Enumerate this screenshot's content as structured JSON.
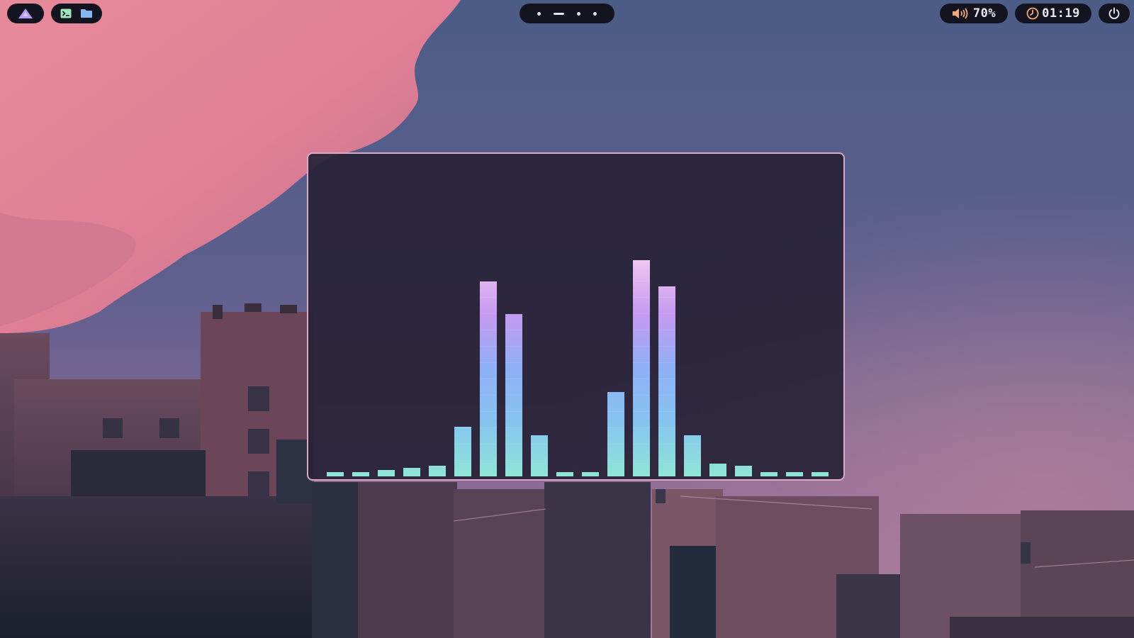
{
  "topbar": {
    "launcher": {
      "icon": "arch-logo-icon"
    },
    "apps": [
      {
        "icon": "terminal-icon"
      },
      {
        "icon": "folder-icon"
      }
    ],
    "workspaces": [
      {
        "active": false
      },
      {
        "active": true
      },
      {
        "active": false
      },
      {
        "active": false
      }
    ],
    "volume": {
      "icon": "speaker-volume-icon",
      "label": "70%"
    },
    "clock": {
      "icon": "clock-icon",
      "time": "01:19"
    },
    "power": {
      "icon": "power-icon"
    }
  },
  "colors": {
    "bar_background": "#141420",
    "window_border": "#d9a9c6",
    "window_background": "#2a2338",
    "bar_gradient": [
      "#8fe6d6",
      "#86c4f0",
      "#8fb0f6",
      "#c69af0",
      "#eec6f0"
    ],
    "volume_icon": "#f0a878",
    "clock_icon": "#f0a878"
  },
  "visualizer": {
    "bar_levels": [
      0.02,
      0.02,
      0.03,
      0.04,
      0.05,
      0.23,
      0.9,
      0.75,
      0.19,
      0.02,
      0.02,
      0.39,
      1.0,
      0.88,
      0.19,
      0.06,
      0.05,
      0.02,
      0.02,
      0.02
    ]
  }
}
